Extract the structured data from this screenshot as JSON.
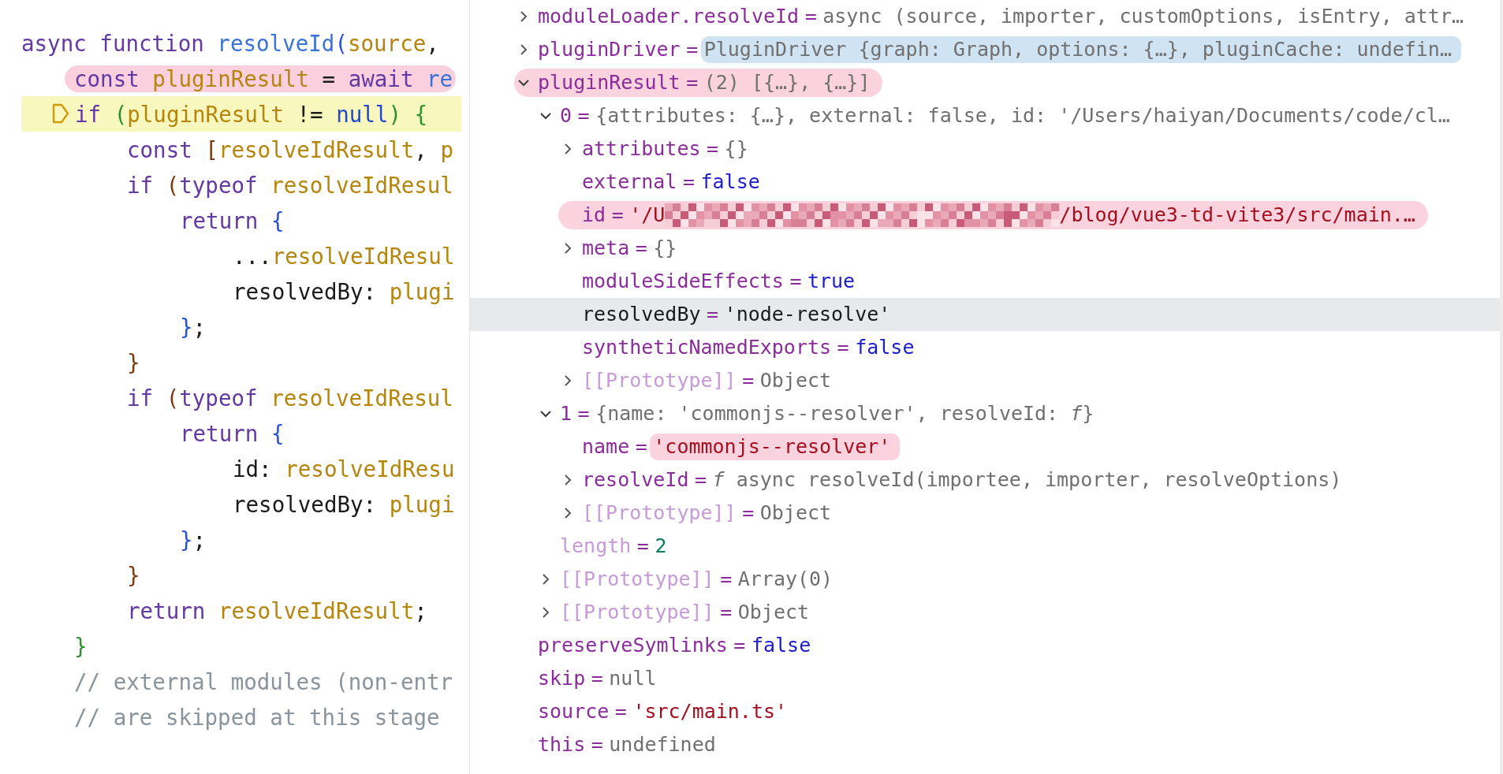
{
  "editor": {
    "lines": [
      {
        "highlighted": false,
        "current": false,
        "tokens": [
          {
            "text": "async function ",
            "kind": "keyword"
          },
          {
            "text": "resolveId",
            "kind": "function"
          },
          {
            "text": "(",
            "kind": "bracket",
            "color": "#2453d6"
          },
          {
            "text": "source",
            "kind": "variable"
          },
          {
            "text": ",",
            "kind": "plain"
          }
        ],
        "children": [
          {
            "highlighted": true,
            "current": false,
            "tokens": [
              {
                "text": "const ",
                "kind": "keyword"
              },
              {
                "text": "pluginResult",
                "kind": "variable"
              },
              {
                "text": " = ",
                "kind": "plain"
              },
              {
                "text": "await ",
                "kind": "keyword"
              },
              {
                "text": "re",
                "kind": "function"
              }
            ]
          },
          {
            "highlighted": false,
            "current": true,
            "tokens": [
              {
                "text": "if ",
                "kind": "keyword"
              },
              {
                "text": "(",
                "kind": "bracket",
                "color": "#2f8f2f"
              },
              {
                "text": "pluginResult",
                "kind": "variable"
              },
              {
                "text": " != ",
                "kind": "plain"
              },
              {
                "text": "null",
                "kind": "literal"
              },
              {
                "text": ") {",
                "kind": "bracket",
                "color": "#2f8f2f"
              }
            ],
            "children": [
              {
                "highlighted": false,
                "current": false,
                "tokens": [
                  {
                    "text": "const ",
                    "kind": "keyword"
                  },
                  {
                    "text": "[",
                    "kind": "bracket",
                    "color": "#7a3b12"
                  },
                  {
                    "text": "resolveIdResult",
                    "kind": "variable"
                  },
                  {
                    "text": ", ",
                    "kind": "plain"
                  },
                  {
                    "text": "p",
                    "kind": "variable"
                  }
                ]
              },
              {
                "highlighted": false,
                "current": false,
                "tokens": [
                  {
                    "text": "if ",
                    "kind": "keyword"
                  },
                  {
                    "text": "(",
                    "kind": "bracket",
                    "color": "#7a3b12"
                  },
                  {
                    "text": "typeof ",
                    "kind": "keyword"
                  },
                  {
                    "text": "resolveIdResul",
                    "kind": "variable"
                  }
                ],
                "children": [
                  {
                    "highlighted": false,
                    "current": false,
                    "tokens": [
                      {
                        "text": "return ",
                        "kind": "keyword"
                      },
                      {
                        "text": "{",
                        "kind": "bracket",
                        "color": "#2453d6"
                      }
                    ],
                    "children": [
                      {
                        "highlighted": false,
                        "current": false,
                        "tokens": [
                          {
                            "text": "...",
                            "kind": "plain"
                          },
                          {
                            "text": "resolveIdResul",
                            "kind": "variable"
                          }
                        ]
                      },
                      {
                        "highlighted": false,
                        "current": false,
                        "tokens": [
                          {
                            "text": "resolvedBy: ",
                            "kind": "plain"
                          },
                          {
                            "text": "plugi",
                            "kind": "variable"
                          }
                        ]
                      }
                    ]
                  },
                  {
                    "highlighted": false,
                    "current": false,
                    "tokens": [
                      {
                        "text": "}",
                        "kind": "bracket",
                        "color": "#2453d6"
                      },
                      {
                        "text": ";",
                        "kind": "plain"
                      }
                    ]
                  }
                ]
              },
              {
                "highlighted": false,
                "current": false,
                "tokens": [
                  {
                    "text": "}",
                    "kind": "bracket",
                    "color": "#7a3b12"
                  }
                ]
              },
              {
                "highlighted": false,
                "current": false,
                "tokens": [
                  {
                    "text": "if ",
                    "kind": "keyword"
                  },
                  {
                    "text": "(",
                    "kind": "bracket",
                    "color": "#7a3b12"
                  },
                  {
                    "text": "typeof ",
                    "kind": "keyword"
                  },
                  {
                    "text": "resolveIdResul",
                    "kind": "variable"
                  }
                ],
                "children": [
                  {
                    "highlighted": false,
                    "current": false,
                    "tokens": [
                      {
                        "text": "return ",
                        "kind": "keyword"
                      },
                      {
                        "text": "{",
                        "kind": "bracket",
                        "color": "#2453d6"
                      }
                    ],
                    "children": [
                      {
                        "highlighted": false,
                        "current": false,
                        "tokens": [
                          {
                            "text": "id: ",
                            "kind": "plain"
                          },
                          {
                            "text": "resolveIdResu",
                            "kind": "variable"
                          }
                        ]
                      },
                      {
                        "highlighted": false,
                        "current": false,
                        "tokens": [
                          {
                            "text": "resolvedBy: ",
                            "kind": "plain"
                          },
                          {
                            "text": "plugi",
                            "kind": "variable"
                          }
                        ]
                      }
                    ]
                  },
                  {
                    "highlighted": false,
                    "current": false,
                    "tokens": [
                      {
                        "text": "}",
                        "kind": "bracket",
                        "color": "#2453d6"
                      },
                      {
                        "text": ";",
                        "kind": "plain"
                      }
                    ]
                  }
                ]
              },
              {
                "highlighted": false,
                "current": false,
                "tokens": [
                  {
                    "text": "}",
                    "kind": "bracket",
                    "color": "#7a3b12"
                  }
                ]
              },
              {
                "highlighted": false,
                "current": false,
                "tokens": [
                  {
                    "text": "return ",
                    "kind": "keyword"
                  },
                  {
                    "text": "resolveIdResult",
                    "kind": "variable"
                  },
                  {
                    "text": ";",
                    "kind": "plain"
                  }
                ]
              }
            ]
          },
          {
            "highlighted": false,
            "current": false,
            "tokens": [
              {
                "text": "}",
                "kind": "bracket",
                "color": "#2f8f2f"
              }
            ]
          },
          {
            "highlighted": false,
            "current": false,
            "tokens": [
              {
                "text": "// external modules (non-entr",
                "kind": "comment"
              }
            ]
          },
          {
            "highlighted": false,
            "current": false,
            "tokens": [
              {
                "text": "// are skipped at this stage",
                "kind": "comment"
              }
            ]
          }
        ]
      }
    ]
  },
  "debugger": {
    "rows": [
      {
        "name": "moduleLoader.resolveId",
        "internal": false,
        "operator": "=",
        "value": [
          {
            "text": "async (source, importer, customOptions, isEntry, attr…",
            "kind": "summary"
          }
        ],
        "kind": "group",
        "expanded": false,
        "selected": false,
        "highlighted": false,
        "value_highlighted": false
      },
      {
        "name": "pluginDriver",
        "internal": false,
        "operator": "=",
        "value": [
          {
            "text": "PluginDriver {graph: Graph, options: {…}, pluginCache: undefin…",
            "kind": "summary"
          }
        ],
        "kind": "group",
        "expanded": false,
        "selected": false,
        "highlighted": false,
        "value_highlighted": true,
        "color": "#cfe3f3"
      },
      {
        "name": "pluginResult",
        "internal": false,
        "operator": "=",
        "value": [
          {
            "text": "(2) [{…}, {…}]",
            "kind": "summary"
          }
        ],
        "kind": "group",
        "expanded": true,
        "selected": false,
        "highlighted": true,
        "value_highlighted": false,
        "color": "#fbd3df",
        "children": [
          {
            "name": "0",
            "internal": false,
            "operator": "=",
            "value": [
              {
                "text": "{attributes: {…}, external: false, id: '/Users/haiyan/Documents/code/cl…",
                "kind": "summary"
              }
            ],
            "kind": "group",
            "expanded": true,
            "selected": false,
            "highlighted": false,
            "value_highlighted": false,
            "children": [
              {
                "name": "attributes",
                "internal": false,
                "operator": "=",
                "value": [
                  {
                    "text": "{}",
                    "kind": "summary"
                  }
                ],
                "kind": "group",
                "expanded": false,
                "selected": false,
                "highlighted": false,
                "value_highlighted": false
              },
              {
                "name": "external",
                "internal": false,
                "operator": "=",
                "value": [
                  {
                    "text": "false",
                    "kind": "keyword"
                  }
                ],
                "kind": "value",
                "selected": false,
                "highlighted": false,
                "value_highlighted": false
              },
              {
                "name": "id",
                "internal": false,
                "operator": "=",
                "value": [
                  {
                    "text": "'/U",
                    "kind": "string"
                  },
                  {
                    "kind": "redacted"
                  },
                  {
                    "text": "/blog/vue3-td-vite3/src/main.…",
                    "kind": "string"
                  }
                ],
                "kind": "value",
                "selected": false,
                "highlighted": true,
                "value_highlighted": false,
                "color": "#fbd3df"
              },
              {
                "name": "meta",
                "internal": false,
                "operator": "=",
                "value": [
                  {
                    "text": "{}",
                    "kind": "summary"
                  }
                ],
                "kind": "group",
                "expanded": false,
                "selected": false,
                "highlighted": false,
                "value_highlighted": false
              },
              {
                "name": "moduleSideEffects",
                "internal": false,
                "operator": "=",
                "value": [
                  {
                    "text": "true",
                    "kind": "keyword"
                  }
                ],
                "kind": "value",
                "selected": false,
                "highlighted": false,
                "value_highlighted": false
              },
              {
                "name": "resolvedBy",
                "internal": false,
                "operator": "=",
                "value": [
                  {
                    "text": "'node-resolve'",
                    "kind": "string"
                  }
                ],
                "kind": "value",
                "selected": true,
                "highlighted": false,
                "value_highlighted": false
              },
              {
                "name": "syntheticNamedExports",
                "internal": false,
                "operator": "=",
                "value": [
                  {
                    "text": "false",
                    "kind": "keyword"
                  }
                ],
                "kind": "value",
                "selected": false,
                "highlighted": false,
                "value_highlighted": false
              },
              {
                "name": "[[Prototype]]",
                "internal": true,
                "operator": "=",
                "value": [
                  {
                    "text": "Object",
                    "kind": "summary"
                  }
                ],
                "kind": "group",
                "expanded": false,
                "selected": false,
                "highlighted": false,
                "value_highlighted": false
              }
            ]
          },
          {
            "name": "1",
            "internal": false,
            "operator": "=",
            "value": [
              {
                "text": "{name: 'commonjs--resolver', resolveId: *f*}",
                "kind": "summary"
              }
            ],
            "kind": "group",
            "expanded": true,
            "selected": false,
            "highlighted": false,
            "value_highlighted": false,
            "children": [
              {
                "name": "name",
                "internal": false,
                "operator": "=",
                "value": [
                  {
                    "text": "'commonjs--resolver'",
                    "kind": "string"
                  }
                ],
                "kind": "value",
                "selected": false,
                "highlighted": false,
                "value_highlighted": true,
                "color": "#fbd3df"
              },
              {
                "name": "resolveId",
                "internal": false,
                "operator": "=",
                "value": [
                  {
                    "text": "*f* async resolveId(importee, importer, resolveOptions)",
                    "kind": "summary"
                  }
                ],
                "kind": "group",
                "expanded": false,
                "selected": false,
                "highlighted": false,
                "value_highlighted": false
              },
              {
                "name": "[[Prototype]]",
                "internal": true,
                "operator": "=",
                "value": [
                  {
                    "text": "Object",
                    "kind": "summary"
                  }
                ],
                "kind": "group",
                "expanded": false,
                "selected": false,
                "highlighted": false,
                "value_highlighted": false
              }
            ]
          },
          {
            "name": "length",
            "internal": true,
            "operator": "=",
            "value": [
              {
                "text": "2",
                "kind": "number"
              }
            ],
            "kind": "value",
            "selected": false,
            "highlighted": false,
            "value_highlighted": false
          },
          {
            "name": "[[Prototype]]",
            "internal": true,
            "operator": "=",
            "value": [
              {
                "text": "Array(0)",
                "kind": "summary"
              }
            ],
            "kind": "group",
            "expanded": false,
            "selected": false,
            "highlighted": false,
            "value_highlighted": false
          },
          {
            "name": "[[Prototype]]",
            "internal": true,
            "operator": "=",
            "value": [
              {
                "text": "Object",
                "kind": "summary"
              }
            ],
            "kind": "group",
            "expanded": false,
            "selected": false,
            "highlighted": false,
            "value_highlighted": false
          }
        ]
      },
      {
        "name": "preserveSymlinks",
        "internal": false,
        "operator": "=",
        "value": [
          {
            "text": "false",
            "kind": "keyword"
          }
        ],
        "kind": "value",
        "selected": false,
        "highlighted": false,
        "value_highlighted": false
      },
      {
        "name": "skip",
        "internal": false,
        "operator": "=",
        "value": [
          {
            "text": "null",
            "kind": "summary"
          }
        ],
        "kind": "value",
        "selected": false,
        "highlighted": false,
        "value_highlighted": false
      },
      {
        "name": "source",
        "internal": false,
        "operator": "=",
        "value": [
          {
            "text": "'src/main.ts'",
            "kind": "string"
          }
        ],
        "kind": "value",
        "selected": false,
        "highlighted": false,
        "value_highlighted": false
      },
      {
        "name": "this",
        "internal": false,
        "operator": "=",
        "value": [
          {
            "text": "undefined",
            "kind": "summary"
          }
        ],
        "kind": "value",
        "selected": false,
        "highlighted": false,
        "value_highlighted": false
      }
    ]
  }
}
